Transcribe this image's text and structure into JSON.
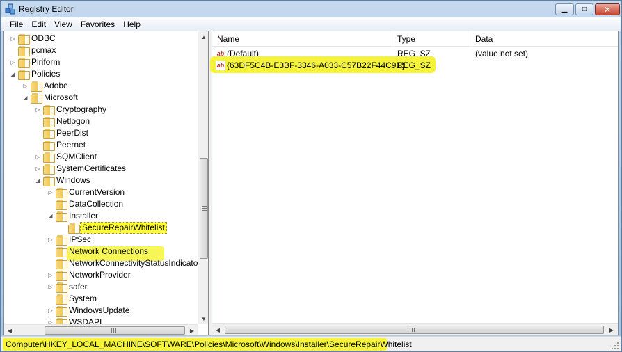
{
  "window": {
    "title": "Registry Editor",
    "min_glyph": "▁",
    "max_glyph": "□",
    "close_glyph": "✕",
    "app_icon": "registry-cubes-icon"
  },
  "menu": [
    "File",
    "Edit",
    "View",
    "Favorites",
    "Help"
  ],
  "tree": [
    {
      "label": "ODBC",
      "depth": 1,
      "expander": "collapsed"
    },
    {
      "label": "pcmax",
      "depth": 1,
      "expander": "none"
    },
    {
      "label": "Piriform",
      "depth": 1,
      "expander": "collapsed"
    },
    {
      "label": "Policies",
      "depth": 1,
      "expander": "expanded"
    },
    {
      "label": "Adobe",
      "depth": 2,
      "expander": "collapsed"
    },
    {
      "label": "Microsoft",
      "depth": 2,
      "expander": "expanded"
    },
    {
      "label": "Cryptography",
      "depth": 3,
      "expander": "collapsed"
    },
    {
      "label": "Netlogon",
      "depth": 3,
      "expander": "none"
    },
    {
      "label": "PeerDist",
      "depth": 3,
      "expander": "none"
    },
    {
      "label": "Peernet",
      "depth": 3,
      "expander": "none"
    },
    {
      "label": "SQMClient",
      "depth": 3,
      "expander": "collapsed"
    },
    {
      "label": "SystemCertificates",
      "depth": 3,
      "expander": "collapsed"
    },
    {
      "label": "Windows",
      "depth": 3,
      "expander": "expanded"
    },
    {
      "label": "CurrentVersion",
      "depth": 4,
      "expander": "collapsed"
    },
    {
      "label": "DataCollection",
      "depth": 4,
      "expander": "none"
    },
    {
      "label": "Installer",
      "depth": 4,
      "expander": "expanded"
    },
    {
      "label": "SecureRepairWhitelist",
      "depth": 5,
      "expander": "none",
      "selected": true
    },
    {
      "label": "IPSec",
      "depth": 4,
      "expander": "collapsed"
    },
    {
      "label": "Network Connections",
      "depth": 4,
      "expander": "none"
    },
    {
      "label": "NetworkConnectivityStatusIndicator",
      "depth": 4,
      "expander": "none"
    },
    {
      "label": "NetworkProvider",
      "depth": 4,
      "expander": "collapsed"
    },
    {
      "label": "safer",
      "depth": 4,
      "expander": "collapsed"
    },
    {
      "label": "System",
      "depth": 4,
      "expander": "none"
    },
    {
      "label": "WindowsUpdate",
      "depth": 4,
      "expander": "collapsed"
    },
    {
      "label": "WSDAPI",
      "depth": 4,
      "expander": "collapsed"
    }
  ],
  "list": {
    "columns": [
      "Name",
      "Type",
      "Data"
    ],
    "rows": [
      {
        "name": "(Default)",
        "type": "REG_SZ",
        "data": "(value not set)",
        "icon": "string-value-icon"
      },
      {
        "name": "{63DF5C4B-E3BF-3346-A033-C57B22F44C9E}",
        "type": "REG_SZ",
        "data": "",
        "icon": "string-value-icon"
      }
    ]
  },
  "status": {
    "path": "Computer\\HKEY_LOCAL_MACHINE\\SOFTWARE\\Policies\\Microsoft\\Windows\\Installer\\SecureRepairWhitelist"
  },
  "scroll_glyphs": {
    "up": "▲",
    "down": "▼",
    "left": "◀",
    "right": "▶"
  },
  "colors": {
    "highlight": "#f6f43a",
    "selection": "#ffff33"
  }
}
